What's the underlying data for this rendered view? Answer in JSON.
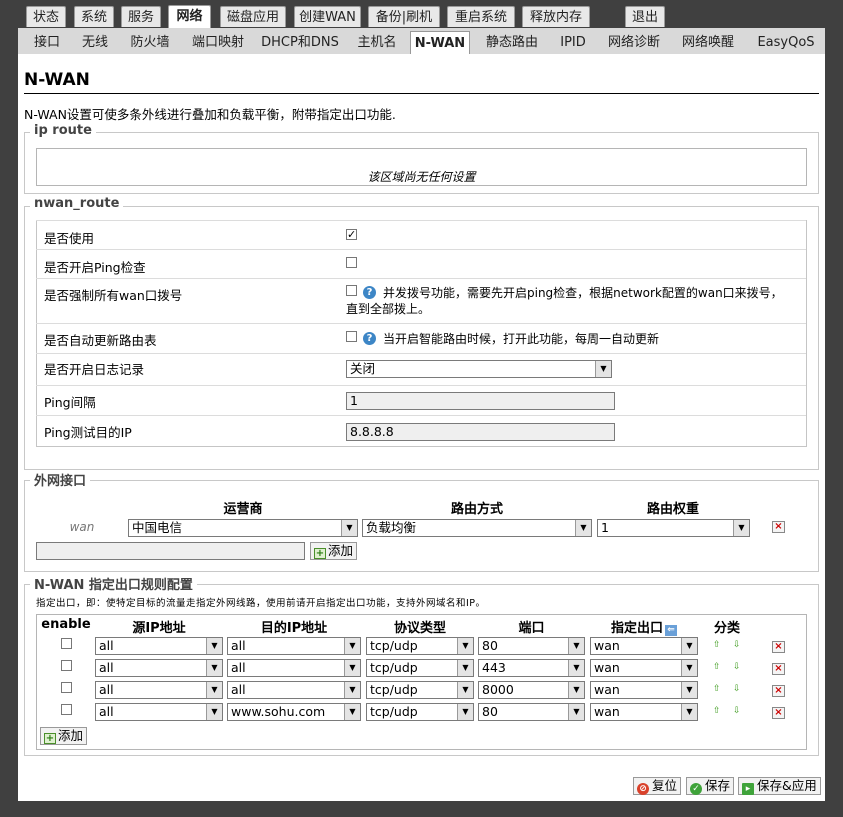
{
  "top_tabs": [
    "状态",
    "系统",
    "服务",
    "网络",
    "磁盘应用",
    "创建WAN",
    "备份|刷机",
    "重启系统",
    "释放内存",
    "退出"
  ],
  "sub_tabs": [
    "接口",
    "无线",
    "防火墙",
    "端口映射",
    "DHCP和DNS",
    "主机名",
    "N-WAN",
    "静态路由",
    "IPID",
    "网络诊断",
    "网络唤醒",
    "EasyQoS"
  ],
  "page": {
    "title": "N-WAN",
    "description": "N-WAN设置可使多条外线进行叠加和负载平衡，附带指定出口功能."
  },
  "ip_route": {
    "legend": "ip route",
    "empty_text": "该区域尚无任何设置"
  },
  "nwan_route": {
    "legend": "nwan_route",
    "rows": [
      {
        "label": "是否使用",
        "checked": true
      },
      {
        "label": "是否开启Ping检查",
        "checked": false
      },
      {
        "label": "是否强制所有wan口拨号",
        "checked": false,
        "note1": "并发拨号功能，需要先开启ping检查，根据network配置的wan口来拨号，",
        "note2": "直到全部拨上。"
      },
      {
        "label": "是否自动更新路由表",
        "checked": false,
        "note1": "当开启智能路由时候，打开此功能，每周一自动更新"
      },
      {
        "label": "是否开启日志记录",
        "value": "关闭"
      },
      {
        "label": "Ping间隔",
        "value": "1"
      },
      {
        "label": "Ping测试目的IP",
        "value": "8.8.8.8"
      }
    ]
  },
  "wan_iface": {
    "legend": "外网接口",
    "headers": [
      "运营商",
      "路由方式",
      "路由权重"
    ],
    "row": {
      "name": "wan",
      "isp": "中国电信",
      "mode": "负载均衡",
      "weight": "1"
    },
    "add_label": "添加",
    "new_value": ""
  },
  "rules": {
    "legend": "N-WAN 指定出口规则配置",
    "description": "指定出口，即：使特定目标的流量走指定外网线路，使用前请开启指定出口功能，支持外网域名和IP。",
    "headers": [
      "enable",
      "源IP地址",
      "目的IP地址",
      "协议类型",
      "端口",
      "指定出口",
      "分类"
    ],
    "rows": [
      {
        "src": "all",
        "dst": "all",
        "proto": "tcp/udp",
        "port": "80",
        "out": "wan"
      },
      {
        "src": "all",
        "dst": "all",
        "proto": "tcp/udp",
        "port": "443",
        "out": "wan"
      },
      {
        "src": "all",
        "dst": "all",
        "proto": "tcp/udp",
        "port": "8000",
        "out": "wan"
      },
      {
        "src": "all",
        "dst": "www.sohu.com",
        "proto": "tcp/udp",
        "port": "80",
        "out": "wan"
      }
    ],
    "add_label": "添加"
  },
  "footer": {
    "reset": "复位",
    "save": "保存",
    "save_apply": "保存&应用"
  }
}
